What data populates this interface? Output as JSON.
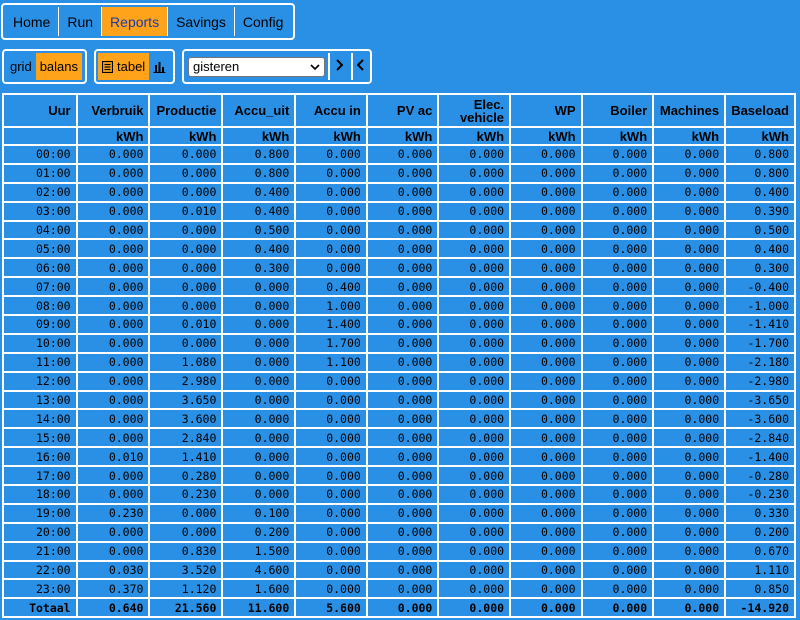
{
  "nav": {
    "items": [
      {
        "label": "Home",
        "active": false
      },
      {
        "label": "Run",
        "active": false
      },
      {
        "label": "Reports",
        "active": true
      },
      {
        "label": "Savings",
        "active": false
      },
      {
        "label": "Config",
        "active": false
      }
    ]
  },
  "source_toggle": {
    "grid_label": "grid",
    "balans_label": "balans",
    "selected": "balans"
  },
  "view_toggle": {
    "tabel_label": "tabel",
    "selected": "tabel",
    "icons": [
      "table-icon",
      "bar-chart-icon"
    ]
  },
  "period": {
    "selected": "gisteren",
    "next_icon": "chevron-right-icon",
    "prev_icon": "chevron-left-icon"
  },
  "colors": {
    "background": "#2a90e6",
    "accent": "#ffa31a",
    "active_text": "#1c3aa8",
    "border": "#ffffff"
  },
  "table": {
    "headers": [
      "Uur",
      "Verbruik",
      "Productie",
      "Accu_uit",
      "Accu in",
      "PV ac",
      "Elec. vehicle",
      "WP",
      "Boiler",
      "Machines",
      "Baseload"
    ],
    "units": [
      "",
      "kWh",
      "kWh",
      "kWh",
      "kWh",
      "kWh",
      "kWh",
      "kWh",
      "kWh",
      "kWh",
      "kWh"
    ],
    "rows": [
      [
        "00:00",
        "0.000",
        "0.000",
        "0.800",
        "0.000",
        "0.000",
        "0.000",
        "0.000",
        "0.000",
        "0.000",
        "0.800"
      ],
      [
        "01:00",
        "0.000",
        "0.000",
        "0.800",
        "0.000",
        "0.000",
        "0.000",
        "0.000",
        "0.000",
        "0.000",
        "0.800"
      ],
      [
        "02:00",
        "0.000",
        "0.000",
        "0.400",
        "0.000",
        "0.000",
        "0.000",
        "0.000",
        "0.000",
        "0.000",
        "0.400"
      ],
      [
        "03:00",
        "0.000",
        "0.010",
        "0.400",
        "0.000",
        "0.000",
        "0.000",
        "0.000",
        "0.000",
        "0.000",
        "0.390"
      ],
      [
        "04:00",
        "0.000",
        "0.000",
        "0.500",
        "0.000",
        "0.000",
        "0.000",
        "0.000",
        "0.000",
        "0.000",
        "0.500"
      ],
      [
        "05:00",
        "0.000",
        "0.000",
        "0.400",
        "0.000",
        "0.000",
        "0.000",
        "0.000",
        "0.000",
        "0.000",
        "0.400"
      ],
      [
        "06:00",
        "0.000",
        "0.000",
        "0.300",
        "0.000",
        "0.000",
        "0.000",
        "0.000",
        "0.000",
        "0.000",
        "0.300"
      ],
      [
        "07:00",
        "0.000",
        "0.000",
        "0.000",
        "0.400",
        "0.000",
        "0.000",
        "0.000",
        "0.000",
        "0.000",
        "-0.400"
      ],
      [
        "08:00",
        "0.000",
        "0.000",
        "0.000",
        "1.000",
        "0.000",
        "0.000",
        "0.000",
        "0.000",
        "0.000",
        "-1.000"
      ],
      [
        "09:00",
        "0.000",
        "0.010",
        "0.000",
        "1.400",
        "0.000",
        "0.000",
        "0.000",
        "0.000",
        "0.000",
        "-1.410"
      ],
      [
        "10:00",
        "0.000",
        "0.000",
        "0.000",
        "1.700",
        "0.000",
        "0.000",
        "0.000",
        "0.000",
        "0.000",
        "-1.700"
      ],
      [
        "11:00",
        "0.000",
        "1.080",
        "0.000",
        "1.100",
        "0.000",
        "0.000",
        "0.000",
        "0.000",
        "0.000",
        "-2.180"
      ],
      [
        "12:00",
        "0.000",
        "2.980",
        "0.000",
        "0.000",
        "0.000",
        "0.000",
        "0.000",
        "0.000",
        "0.000",
        "-2.980"
      ],
      [
        "13:00",
        "0.000",
        "3.650",
        "0.000",
        "0.000",
        "0.000",
        "0.000",
        "0.000",
        "0.000",
        "0.000",
        "-3.650"
      ],
      [
        "14:00",
        "0.000",
        "3.600",
        "0.000",
        "0.000",
        "0.000",
        "0.000",
        "0.000",
        "0.000",
        "0.000",
        "-3.600"
      ],
      [
        "15:00",
        "0.000",
        "2.840",
        "0.000",
        "0.000",
        "0.000",
        "0.000",
        "0.000",
        "0.000",
        "0.000",
        "-2.840"
      ],
      [
        "16:00",
        "0.010",
        "1.410",
        "0.000",
        "0.000",
        "0.000",
        "0.000",
        "0.000",
        "0.000",
        "0.000",
        "-1.400"
      ],
      [
        "17:00",
        "0.000",
        "0.280",
        "0.000",
        "0.000",
        "0.000",
        "0.000",
        "0.000",
        "0.000",
        "0.000",
        "-0.280"
      ],
      [
        "18:00",
        "0.000",
        "0.230",
        "0.000",
        "0.000",
        "0.000",
        "0.000",
        "0.000",
        "0.000",
        "0.000",
        "-0.230"
      ],
      [
        "19:00",
        "0.230",
        "0.000",
        "0.100",
        "0.000",
        "0.000",
        "0.000",
        "0.000",
        "0.000",
        "0.000",
        "0.330"
      ],
      [
        "20:00",
        "0.000",
        "0.000",
        "0.200",
        "0.000",
        "0.000",
        "0.000",
        "0.000",
        "0.000",
        "0.000",
        "0.200"
      ],
      [
        "21:00",
        "0.000",
        "0.830",
        "1.500",
        "0.000",
        "0.000",
        "0.000",
        "0.000",
        "0.000",
        "0.000",
        "0.670"
      ],
      [
        "22:00",
        "0.030",
        "3.520",
        "4.600",
        "0.000",
        "0.000",
        "0.000",
        "0.000",
        "0.000",
        "0.000",
        "1.110"
      ],
      [
        "23:00",
        "0.370",
        "1.120",
        "1.600",
        "0.000",
        "0.000",
        "0.000",
        "0.000",
        "0.000",
        "0.000",
        "0.850"
      ]
    ],
    "totals": [
      "Totaal",
      "0.640",
      "21.560",
      "11.600",
      "5.600",
      "0.000",
      "0.000",
      "0.000",
      "0.000",
      "0.000",
      "-14.920"
    ]
  }
}
